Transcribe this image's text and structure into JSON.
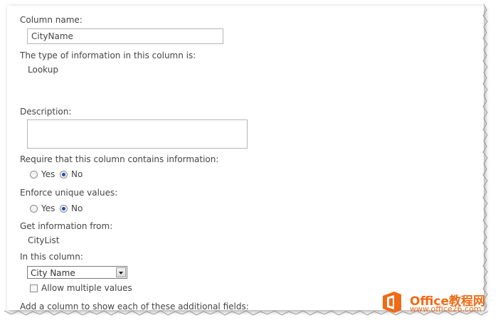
{
  "column_name": {
    "label": "Column name:",
    "value": "CityName"
  },
  "info_type": {
    "label": "The type of information in this column is:",
    "value": "Lookup"
  },
  "description": {
    "label": "Description:",
    "value": ""
  },
  "require": {
    "label": "Require that this column contains information:",
    "yes_label": "Yes",
    "no_label": "No",
    "selected": "No"
  },
  "unique": {
    "label": "Enforce unique values:",
    "yes_label": "Yes",
    "no_label": "No",
    "selected": "No"
  },
  "get_info": {
    "label": "Get information from:",
    "value": "CityList"
  },
  "in_column": {
    "label": "In this column:",
    "selected": "City Name"
  },
  "allow_multiple": {
    "label": "Allow multiple values",
    "checked": false
  },
  "additional_fields": {
    "label": "Add a column to show each of these additional fields:"
  },
  "watermark": {
    "name": "Office教程网",
    "url": "www.office26.com"
  },
  "colors": {
    "radio_selected": "#1f4ea8",
    "watermark": "#f06a17"
  }
}
